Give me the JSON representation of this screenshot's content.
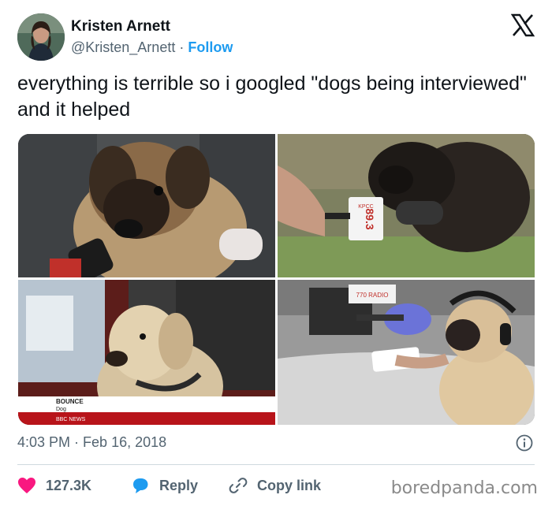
{
  "header": {
    "display_name": "Kristen Arnett",
    "handle": "@Kristen_Arnett",
    "separator": " · ",
    "follow_label": "Follow",
    "platform_icon": "x-logo-icon"
  },
  "tweet": {
    "text": "everything is terrible so i googled \"dogs being interviewed\" and it helped"
  },
  "media": {
    "photos": [
      {
        "subject": "puppy-with-microphone"
      },
      {
        "subject": "puppy-with-radio-mic",
        "mic_flag": "89.3",
        "mic_flag_top": "KPCC"
      },
      {
        "subject": "labrador-on-bbc",
        "caption_name": "BOUNCE",
        "caption_role": "Dog",
        "caption_channel": "BBC NEWS"
      },
      {
        "subject": "pug-with-headphones",
        "sign_text": "770 RADIO"
      }
    ]
  },
  "meta": {
    "time": "4:03 PM",
    "separator": " · ",
    "date": "Feb 16, 2018",
    "info_icon": "info-icon"
  },
  "actions": {
    "like_count": "127.3K",
    "reply_label": "Reply",
    "copy_label": "Copy link"
  },
  "watermark": "boredpanda.com",
  "colors": {
    "accent": "#1d9bf0",
    "like": "#f91880",
    "text": "#0f1419",
    "muted": "#536471",
    "divider": "#cfd9de"
  }
}
